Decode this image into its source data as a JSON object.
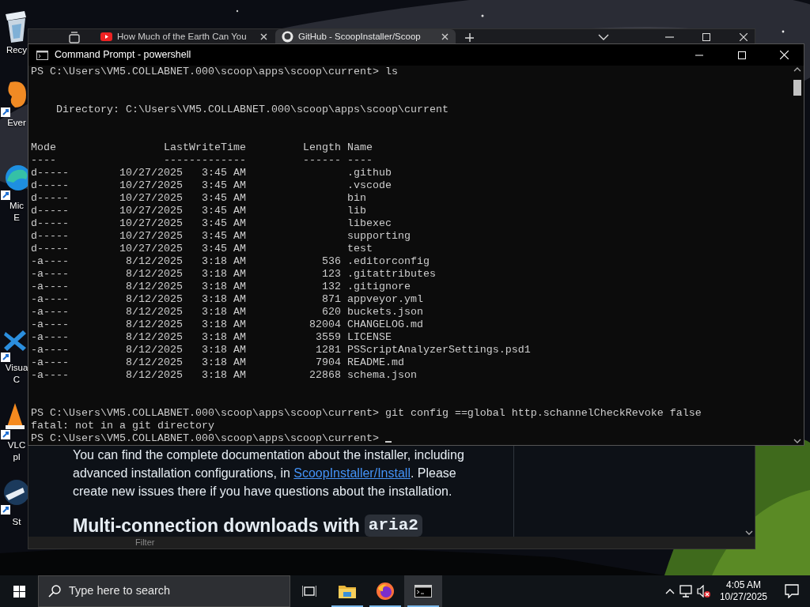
{
  "desktop": {
    "icons": [
      {
        "kind": "recycle",
        "label": "Recy"
      },
      {
        "kind": "elephant",
        "label": "Ever"
      },
      {
        "kind": "edge",
        "label": "Mic E"
      },
      {
        "kind": "code",
        "label": "Visua C"
      },
      {
        "kind": "cone",
        "label": "VLC pl"
      },
      {
        "kind": "steam",
        "label": "St"
      }
    ]
  },
  "browser": {
    "tabs": [
      {
        "kind": "video",
        "title": "How Much of the Earth Can You",
        "selected": false
      },
      {
        "kind": "github",
        "title": "GitHub - ScoopInstaller/Scoop",
        "selected": true
      }
    ],
    "page": {
      "paragraph": [
        {
          "kind": "text",
          "text": "You can find the complete documentation about the installer, including advanced installation configurations, in "
        },
        {
          "kind": "link",
          "text": "ScoopInstaller/Install"
        },
        {
          "kind": "text",
          "text": ". Please create new issues there if you have questions about the installation."
        }
      ],
      "heading": "Multi-connection downloads with",
      "heading_code": "aria2"
    },
    "filter_bar": {
      "placeholder": "Filter"
    }
  },
  "console": {
    "title": "Command Prompt - powershell",
    "output": [
      {
        "kind": "prompt",
        "prompt": "PS C:\\Users\\VM5.COLLABNET.000\\scoop\\apps\\scoop\\current>",
        "command": "ls",
        "cursor": false
      },
      {
        "kind": "directory",
        "label": "Directory:",
        "path": "C:\\Users\\VM5.COLLABNET.000\\scoop\\apps\\scoop\\current"
      },
      {
        "kind": "table",
        "headers": [
          "Mode",
          "LastWriteTime",
          "Length",
          "Name"
        ],
        "rule": "----                 -------------         ------ ----",
        "rows": [
          {
            "mode": "d-----",
            "date": "10/27/2025",
            "time": "3:45 AM",
            "name": ".github"
          },
          {
            "mode": "d-----",
            "date": "10/27/2025",
            "time": "3:45 AM",
            "name": ".vscode"
          },
          {
            "mode": "d-----",
            "date": "10/27/2025",
            "time": "3:45 AM",
            "name": "bin"
          },
          {
            "mode": "d-----",
            "date": "10/27/2025",
            "time": "3:45 AM",
            "name": "lib"
          },
          {
            "mode": "d-----",
            "date": "10/27/2025",
            "time": "3:45 AM",
            "name": "libexec"
          },
          {
            "mode": "d-----",
            "date": "10/27/2025",
            "time": "3:45 AM",
            "name": "supporting"
          },
          {
            "mode": "d-----",
            "date": "10/27/2025",
            "time": "3:45 AM",
            "name": "test"
          },
          {
            "mode": "-a----",
            "date": "8/12/2025",
            "time": "3:18 AM",
            "length": "536",
            "name": ".editorconfig"
          },
          {
            "mode": "-a----",
            "date": "8/12/2025",
            "time": "3:18 AM",
            "length": "123",
            "name": ".gitattributes"
          },
          {
            "mode": "-a----",
            "date": "8/12/2025",
            "time": "3:18 AM",
            "length": "132",
            "name": ".gitignore"
          },
          {
            "mode": "-a----",
            "date": "8/12/2025",
            "time": "3:18 AM",
            "length": "871",
            "name": "appveyor.yml"
          },
          {
            "mode": "-a----",
            "date": "8/12/2025",
            "time": "3:18 AM",
            "length": "620",
            "name": "buckets.json"
          },
          {
            "mode": "-a----",
            "date": "8/12/2025",
            "time": "3:18 AM",
            "length": "82004",
            "name": "CHANGELOG.md"
          },
          {
            "mode": "-a----",
            "date": "8/12/2025",
            "time": "3:18 AM",
            "length": "3559",
            "name": "LICENSE"
          },
          {
            "mode": "-a----",
            "date": "8/12/2025",
            "time": "3:18 AM",
            "length": "1281",
            "name": "PSScriptAnalyzerSettings.psd1"
          },
          {
            "mode": "-a----",
            "date": "8/12/2025",
            "time": "3:18 AM",
            "length": "7904",
            "name": "README.md"
          },
          {
            "mode": "-a----",
            "date": "8/12/2025",
            "time": "3:18 AM",
            "length": "22868",
            "name": "schema.json"
          }
        ]
      },
      {
        "kind": "prompt",
        "prompt": "PS C:\\Users\\VM5.COLLABNET.000\\scoop\\apps\\scoop\\current>",
        "command": "git config ==global http.schannelCheckRevoke false",
        "cursor": false
      },
      {
        "kind": "error",
        "text": "fatal: not in a git directory"
      },
      {
        "kind": "prompt",
        "prompt": "PS C:\\Users\\VM5.COLLABNET.000\\scoop\\apps\\scoop\\current>",
        "cursor": true
      }
    ]
  },
  "taskbar": {
    "search": {
      "placeholder": "Type here to search"
    },
    "apps": [
      {
        "kind": "taskview",
        "selected": false
      },
      {
        "kind": "folder",
        "selected": false
      },
      {
        "kind": "firefox",
        "selected": false
      },
      {
        "kind": "terminal",
        "selected": true
      }
    ],
    "clock": {
      "time": "4:05 AM",
      "date": "10/27/2025"
    }
  }
}
